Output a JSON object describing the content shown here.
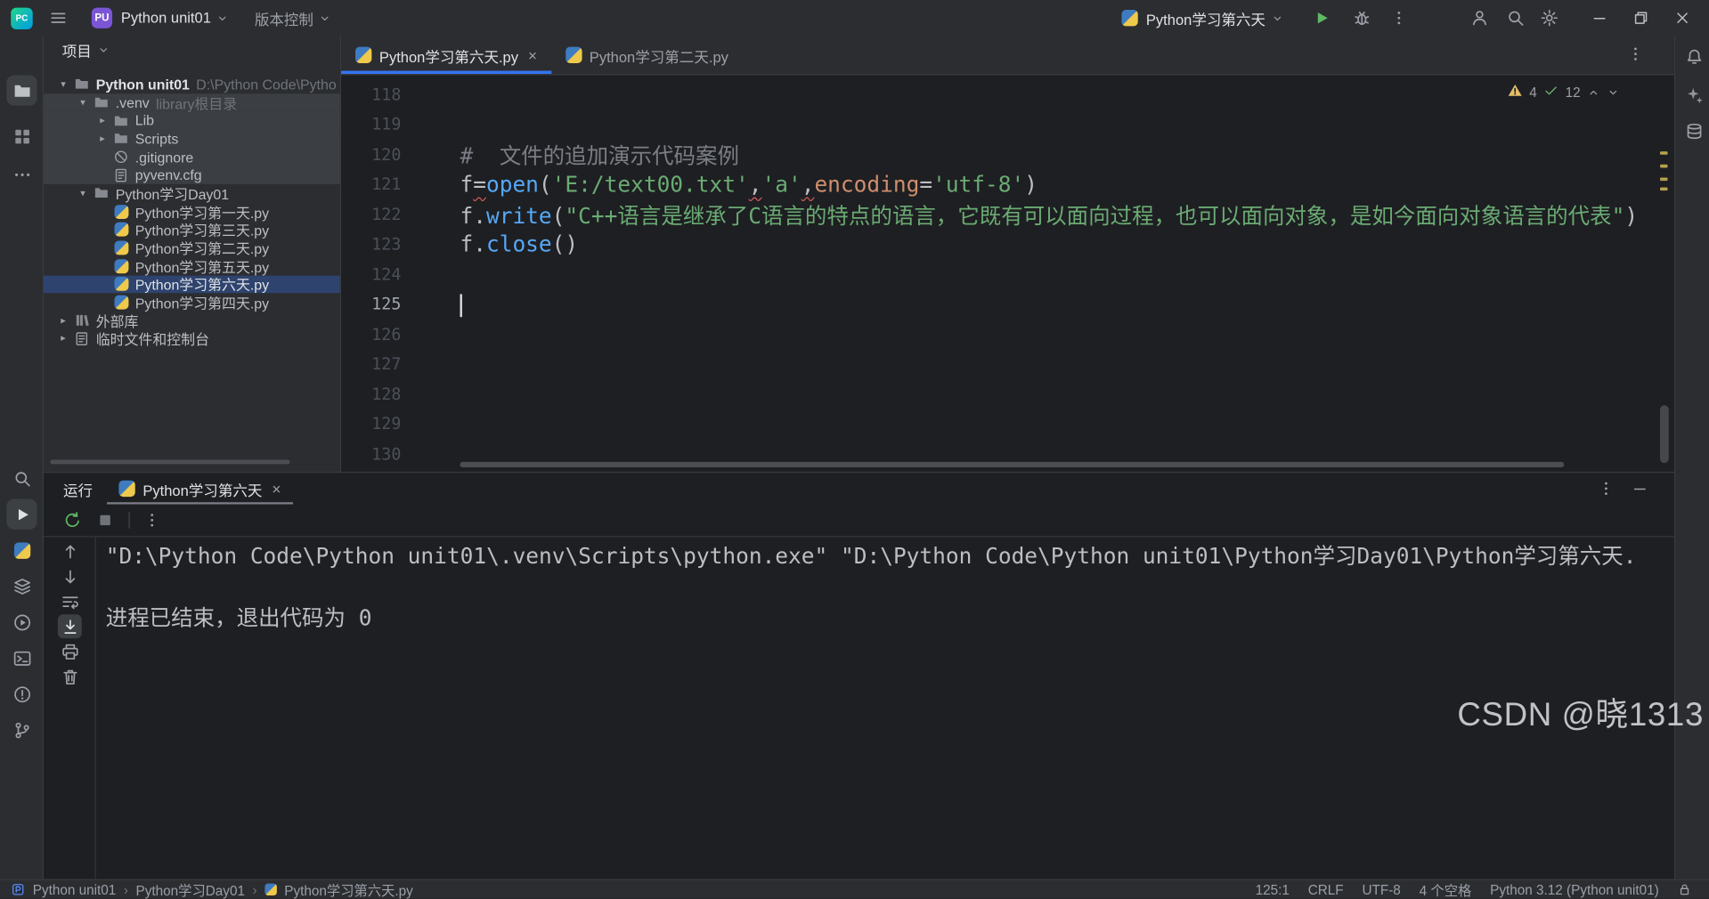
{
  "colors": {
    "accent_blue": "#3574f0",
    "selection_blue": "#2e436e",
    "string_green": "#6aab73",
    "function_blue": "#56a8f5",
    "parameter_orange": "#cf8e6d",
    "comment_gray": "#7a7e85",
    "warning_yellow": "#e8bf6a",
    "run_green": "#5fb865",
    "panel_bg": "#2b2d30",
    "editor_bg": "#1e1f22"
  },
  "title_bar": {
    "project_badge": "PU",
    "project_name": "Python unit01",
    "vcs_label": "版本控制",
    "run_config": "Python学习第六天"
  },
  "left_strip": {
    "items": [
      {
        "icon": "folder",
        "name": "project-toolwindow",
        "active": true
      },
      {
        "icon": "structure",
        "name": "structure-toolwindow"
      },
      {
        "icon": "ellipsis",
        "name": "more-tool-windows"
      },
      {
        "icon": "search",
        "name": "find-toolwindow"
      },
      {
        "icon": "play-box",
        "name": "run-toolwindow",
        "active": true
      },
      {
        "icon": "python",
        "name": "python-console"
      },
      {
        "icon": "services",
        "name": "services-toolwindow"
      },
      {
        "icon": "run-circle",
        "name": "run-anything"
      },
      {
        "icon": "terminal",
        "name": "terminal-toolwindow"
      },
      {
        "icon": "problems",
        "name": "problems-toolwindow"
      },
      {
        "icon": "branch",
        "name": "version-control-toolwindow"
      }
    ]
  },
  "right_strip": [
    {
      "icon": "bell",
      "name": "notifications"
    },
    {
      "icon": "ai",
      "name": "ai-assistant"
    },
    {
      "icon": "database",
      "name": "database-toolwindow"
    }
  ],
  "project_panel": {
    "header_label": "项目",
    "tree": [
      {
        "label": "Python unit01",
        "suffix": "D:\\Python Code\\Pytho",
        "indent": 0,
        "chevron": "down",
        "icon": "folder",
        "bold": true
      },
      {
        "label": ".venv",
        "suffix": "library根目录",
        "indent": 1,
        "chevron": "down",
        "icon": "folder",
        "lib": true
      },
      {
        "label": "Lib",
        "indent": 2,
        "chevron": "right",
        "icon": "folder",
        "lib": true
      },
      {
        "label": "Scripts",
        "indent": 2,
        "chevron": "right",
        "icon": "folder",
        "lib": true
      },
      {
        "label": ".gitignore",
        "indent": 2,
        "icon": "ignore",
        "lib": true
      },
      {
        "label": "pyvenv.cfg",
        "indent": 2,
        "icon": "config",
        "lib": true
      },
      {
        "label": "Python学习Day01",
        "indent": 1,
        "chevron": "down",
        "icon": "folder"
      },
      {
        "label": "Python学习第一天.py",
        "indent": 2,
        "icon": "python"
      },
      {
        "label": "Python学习第三天.py",
        "indent": 2,
        "icon": "python"
      },
      {
        "label": "Python学习第二天.py",
        "indent": 2,
        "icon": "python"
      },
      {
        "label": "Python学习第五天.py",
        "indent": 2,
        "icon": "python"
      },
      {
        "label": "Python学习第六天.py",
        "indent": 2,
        "icon": "python",
        "selected": true
      },
      {
        "label": "Python学习第四天.py",
        "indent": 2,
        "icon": "python"
      },
      {
        "label": "外部库",
        "indent": 0,
        "chevron": "right",
        "icon": "library"
      },
      {
        "label": "临时文件和控制台",
        "indent": 0,
        "chevron": "right",
        "icon": "scratch"
      }
    ]
  },
  "editor": {
    "tabs": [
      {
        "label": "Python学习第六天.py",
        "close": "×",
        "active": true
      },
      {
        "label": "Python学习第二天.py",
        "active": false
      }
    ],
    "inspection": {
      "warnings": "4",
      "results": "12"
    },
    "code_lines": [
      {
        "n": 118,
        "tokens": []
      },
      {
        "n": 119,
        "tokens": []
      },
      {
        "n": 120,
        "tokens": [
          {
            "t": "#  文件的追加演示代码案例",
            "c": "comment"
          }
        ]
      },
      {
        "n": 121,
        "tokens": [
          {
            "t": "f",
            "c": "plain"
          },
          {
            "t": "=",
            "c": "plain",
            "w": true
          },
          {
            "t": "open",
            "c": "func"
          },
          {
            "t": "(",
            "c": "plain"
          },
          {
            "t": "'E:/text00.txt'",
            "c": "str"
          },
          {
            "t": ",",
            "c": "plain",
            "w": true
          },
          {
            "t": "'a'",
            "c": "str"
          },
          {
            "t": ",",
            "c": "plain",
            "w": true
          },
          {
            "t": "encoding",
            "c": "param"
          },
          {
            "t": "=",
            "c": "plain"
          },
          {
            "t": "'utf-8'",
            "c": "str"
          },
          {
            "t": ")",
            "c": "plain"
          }
        ]
      },
      {
        "n": 122,
        "tokens": [
          {
            "t": "f",
            "c": "plain"
          },
          {
            "t": ".",
            "c": "plain"
          },
          {
            "t": "write",
            "c": "func"
          },
          {
            "t": "(",
            "c": "plain"
          },
          {
            "t": "\"C++语言是继承了C语言的特点的语言，它既有可以面向过程，也可以面向对象，是如今面向对象语言的代表\"",
            "c": "str"
          },
          {
            "t": ")",
            "c": "plain"
          }
        ]
      },
      {
        "n": 123,
        "tokens": [
          {
            "t": "f",
            "c": "plain"
          },
          {
            "t": ".",
            "c": "plain"
          },
          {
            "t": "close",
            "c": "func"
          },
          {
            "t": "(",
            "c": "plain"
          },
          {
            "t": ")",
            "c": "plain"
          }
        ]
      },
      {
        "n": 124,
        "tokens": []
      },
      {
        "n": 125,
        "tokens": [],
        "caret": true
      },
      {
        "n": 126,
        "tokens": []
      },
      {
        "n": 127,
        "tokens": []
      },
      {
        "n": 128,
        "tokens": []
      },
      {
        "n": 129,
        "tokens": []
      },
      {
        "n": 130,
        "tokens": []
      }
    ]
  },
  "run_panel": {
    "title": "运行",
    "tab_label": "Python学习第六天",
    "tab_close": "×",
    "gutter_icons": [
      {
        "icon": "up-arrow",
        "name": "prev-occurrence"
      },
      {
        "icon": "down-arrow",
        "name": "next-occurrence"
      },
      {
        "icon": "wrap",
        "name": "soft-wrap"
      },
      {
        "icon": "scroll-end",
        "name": "scroll-to-end",
        "active": true
      },
      {
        "icon": "printer",
        "name": "print-console"
      },
      {
        "icon": "trash",
        "name": "clear-console"
      }
    ],
    "console": [
      "\"D:\\Python Code\\Python unit01\\.venv\\Scripts\\python.exe\" \"D:\\Python Code\\Python unit01\\Python学习Day01\\Python学习第六天.",
      "",
      "进程已结束，退出代码为 0"
    ]
  },
  "status_bar": {
    "breadcrumbs": [
      "Python unit01",
      "Python学习Day01",
      "Python学习第六天.py"
    ],
    "items": [
      "125:1",
      "CRLF",
      "UTF-8",
      "4 个空格",
      "Python 3.12 (Python unit01)"
    ]
  },
  "watermark": "CSDN @晓1313"
}
